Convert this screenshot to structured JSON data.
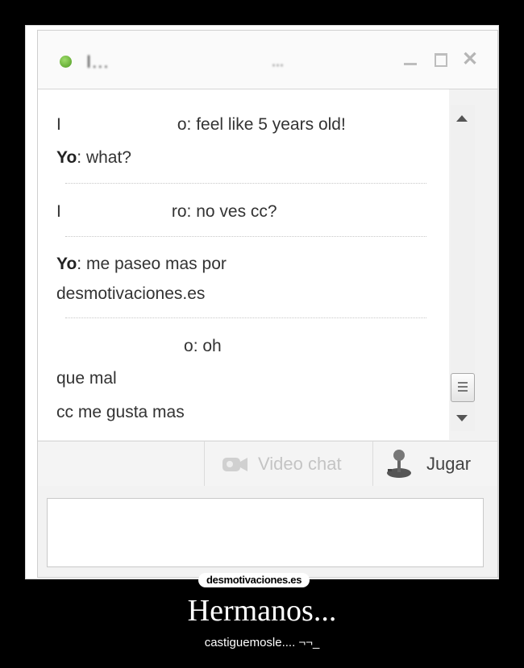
{
  "chat": {
    "contact_name": "I...",
    "contact_name_tail": "...",
    "messages": [
      {
        "prefix": "I",
        "tail": "o",
        "text": ": feel like 5 years old!"
      },
      {
        "sender": "Yo",
        "text": ": what?"
      },
      {
        "prefix": "I",
        "tail": "ro",
        "text": ": no ves cc?"
      },
      {
        "sender": "Yo",
        "text": ": me paseo mas por"
      },
      {
        "text": "desmotivaciones.es"
      },
      {
        "tail": "o",
        "text": ": oh"
      },
      {
        "text": "que mal"
      },
      {
        "text": "cc me gusta mas"
      }
    ],
    "toolbar": {
      "video_chat_label": "Video chat",
      "play_label": "Jugar"
    },
    "message_input_value": ""
  },
  "poster": {
    "brand": "desmotivaciones.es",
    "title": "Hermanos...",
    "subtitle": "castiguemosle.... ¬¬_"
  },
  "colors": {
    "status_online": "#5aa82b",
    "background": "#000000"
  }
}
